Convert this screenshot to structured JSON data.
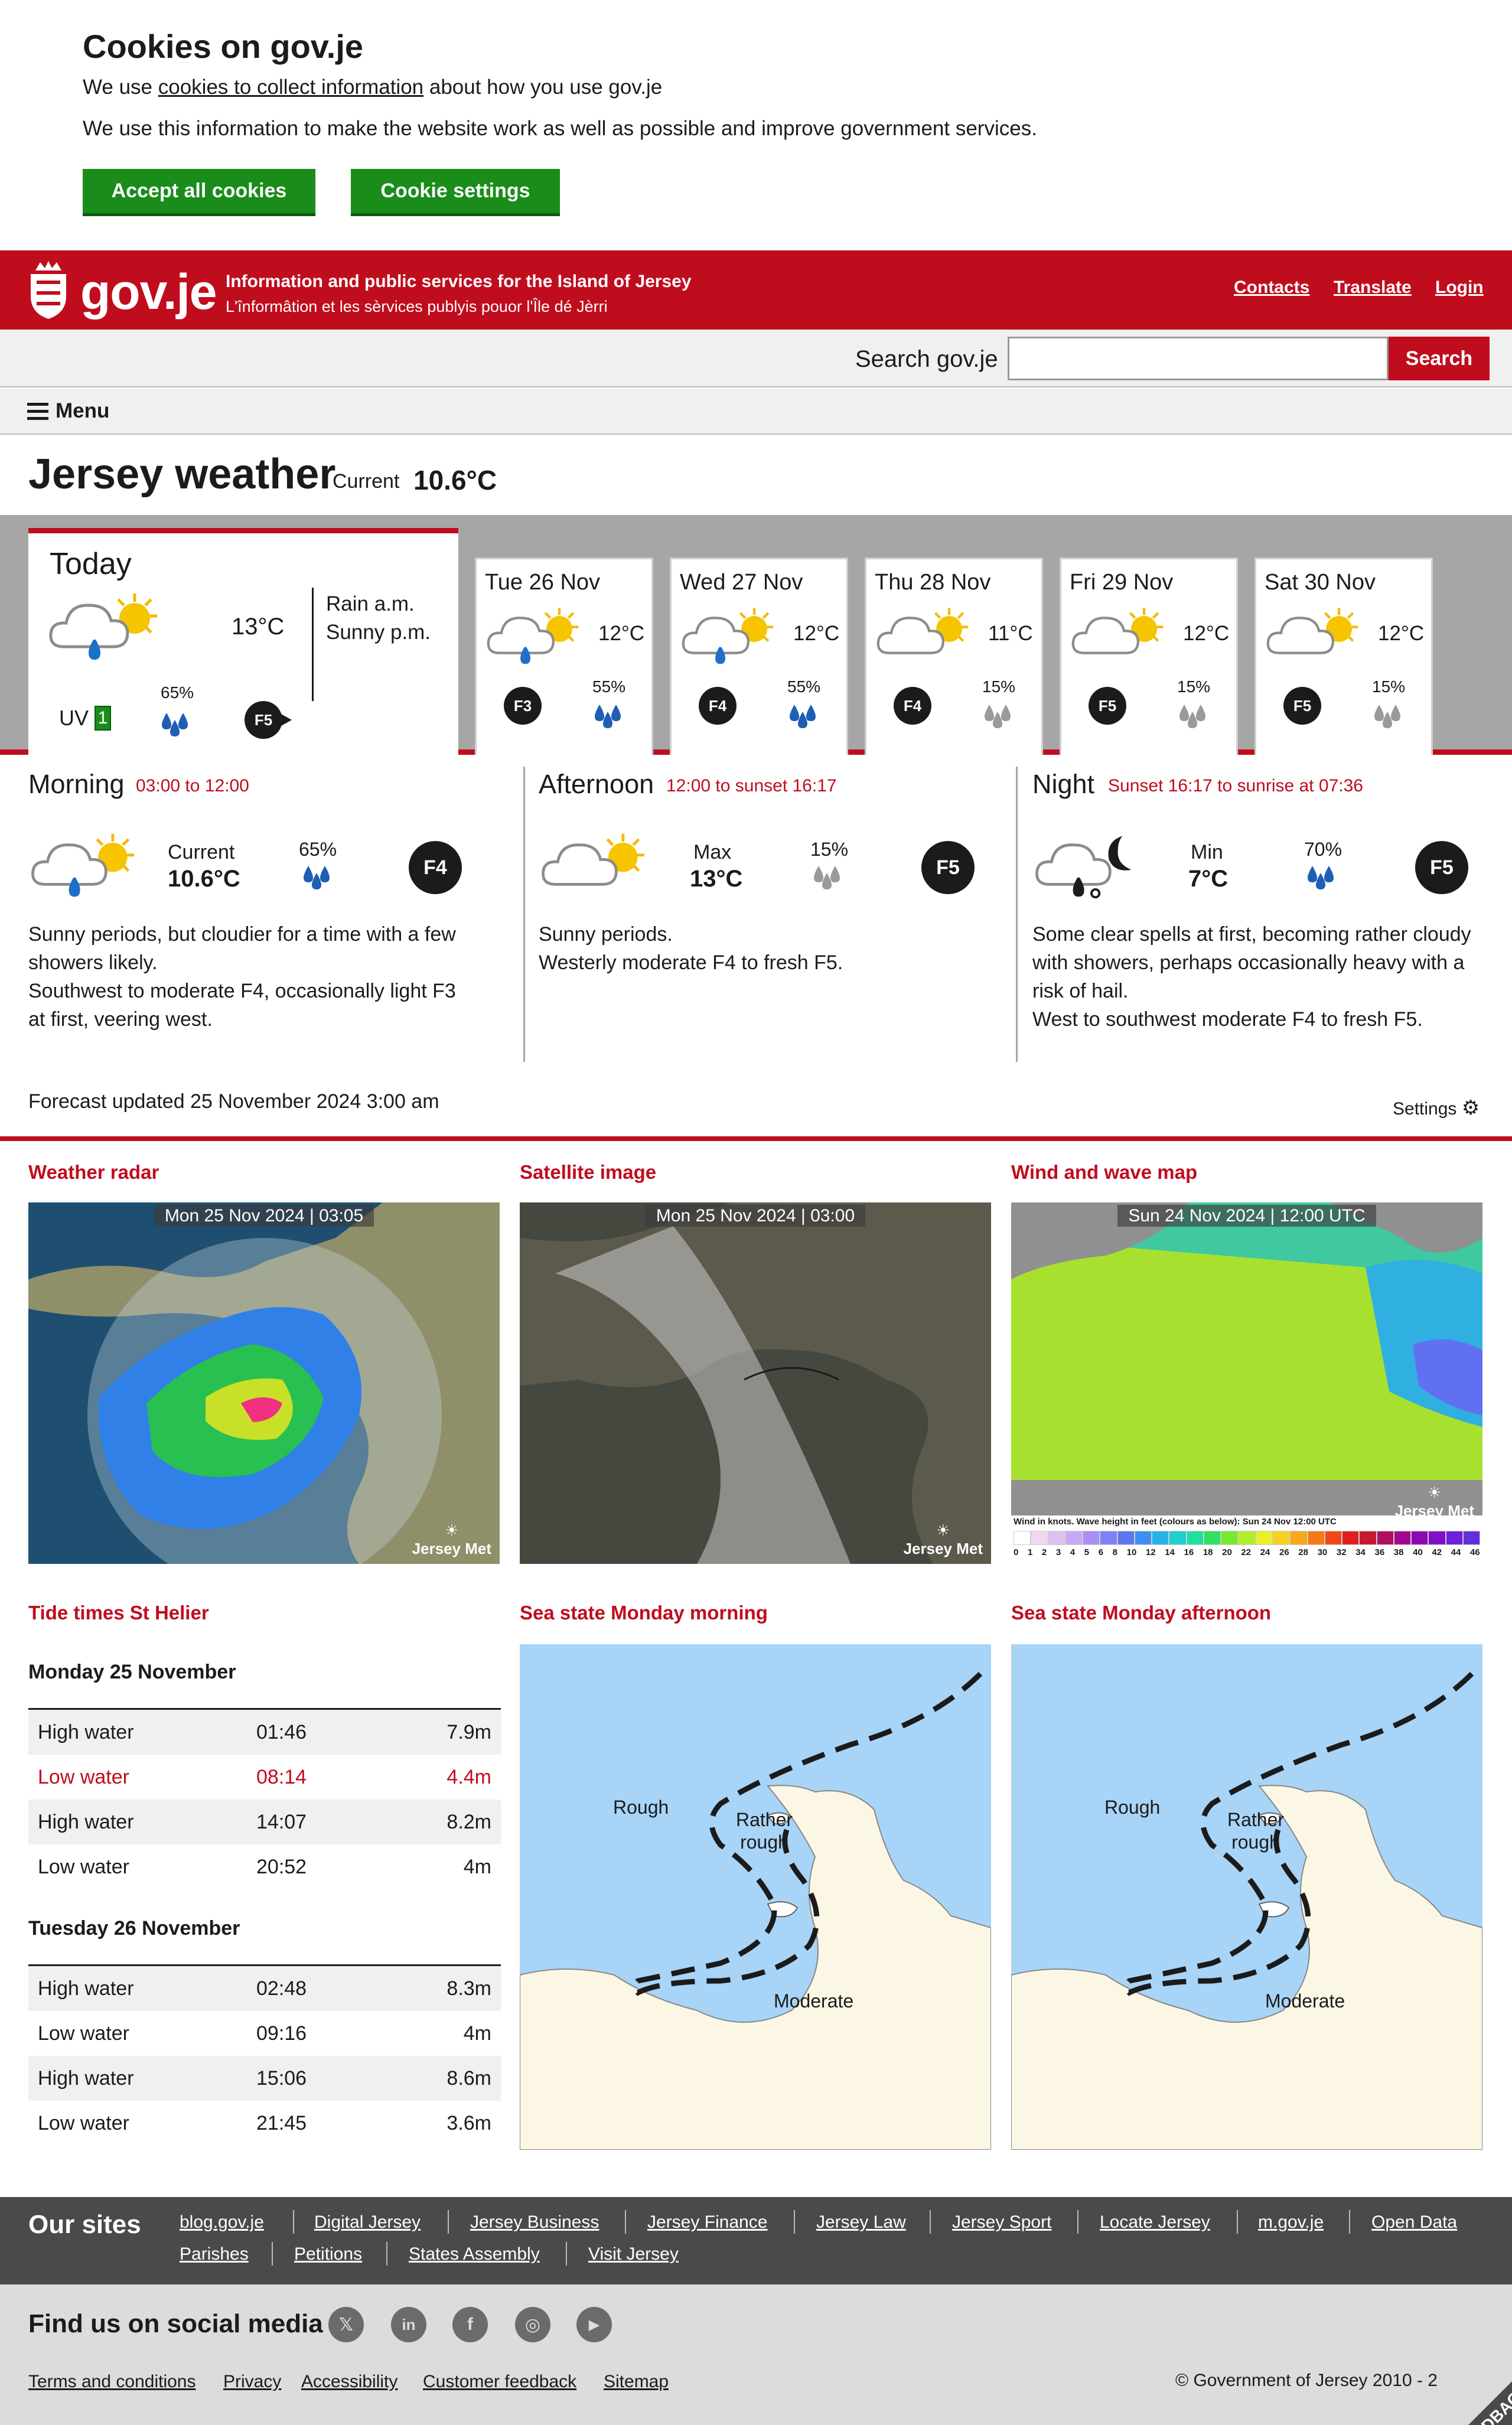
{
  "cookie": {
    "title": "Cookies on gov.je",
    "line1_pre": "We use ",
    "line1_link": "cookies to collect information",
    "line1_post": " about how you use gov.je",
    "line2": "We use this information to make the website work as well as possible and improve government services.",
    "accept_label": "Accept all cookies",
    "settings_label": "Cookie settings"
  },
  "header": {
    "logo": "gov.je",
    "tagline_en": "Information and public services for the Island of Jersey",
    "tagline_jer": "L'înformâtion et les sèrvices publyis pouor l'Île dé Jèrri",
    "links": [
      "Contacts",
      "Translate",
      "Login"
    ]
  },
  "search": {
    "label": "Search gov.je",
    "placeholder": "",
    "button": "Search"
  },
  "menu": {
    "label": "Menu"
  },
  "page": {
    "title": "Jersey weather",
    "current_label": "Current",
    "current_temp": "10.6°C"
  },
  "today": {
    "title": "Today",
    "temp": "13°C",
    "desc1": "Rain a.m.",
    "desc2": "Sunny p.m.",
    "uv_label": "UV",
    "uv_value": "1",
    "rain_pct": "65%",
    "wind": "F5"
  },
  "days": [
    {
      "name": "Tue 26 Nov",
      "temp": "12°C",
      "wind": "F3",
      "rain_pct": "55%"
    },
    {
      "name": "Wed 27 Nov",
      "temp": "12°C",
      "wind": "F4",
      "rain_pct": "55%"
    },
    {
      "name": "Thu 28 Nov",
      "temp": "11°C",
      "wind": "F4",
      "rain_pct": "15%"
    },
    {
      "name": "Fri 29 Nov",
      "temp": "12°C",
      "wind": "F5",
      "rain_pct": "15%"
    },
    {
      "name": "Sat 30 Nov",
      "temp": "12°C",
      "wind": "F5",
      "rain_pct": "15%"
    }
  ],
  "periods": {
    "morning": {
      "title": "Morning",
      "range": "03:00 to 12:00",
      "label": "Current",
      "value": "10.6°C",
      "rain_pct": "65%",
      "wind": "F4",
      "text1": "Sunny periods, but cloudier for a time with a few",
      "text2": "showers likely.",
      "text3": "Southwest to moderate F4, occasionally light F3",
      "text4": "at first, veering west."
    },
    "afternoon": {
      "title": "Afternoon",
      "range": "12:00 to sunset 16:17",
      "label": "Max",
      "value": "13°C",
      "rain_pct": "15%",
      "wind": "F5",
      "text1": "Sunny periods.",
      "text2": "Westerly moderate F4 to fresh F5."
    },
    "night": {
      "title": "Night",
      "range": "Sunset 16:17 to sunrise at 07:36",
      "label": "Min",
      "value": "7°C",
      "rain_pct": "70%",
      "wind": "F5",
      "text1": "Some clear spells at first, becoming rather cloudy",
      "text2": "with showers, perhaps occasionally heavy with a",
      "text3": "risk of hail.",
      "text4": "West to southwest moderate F4 to fresh F5."
    }
  },
  "updated": "Forecast updated 25 November 2024 3:00 am",
  "settings_label": "Settings",
  "maps": {
    "radar": {
      "title": "Weather radar",
      "stamp": "Mon 25 Nov 2024 | 03:05",
      "brand": "Jersey Met"
    },
    "satellite": {
      "title": "Satellite image",
      "stamp": "Mon 25 Nov 2024 | 03:00",
      "brand": "Jersey Met"
    },
    "wind": {
      "title": "Wind and wave map",
      "stamp": "Sun 24 Nov 2024 | 12:00 UTC",
      "brand": "Jersey Met",
      "legend": "Wind in knots. Wave height in feet (colours as below): Sun 24 Nov 12:00 UTC",
      "scale": [
        "0",
        "1",
        "2",
        "3",
        "4",
        "5",
        "6",
        "8",
        "10",
        "12",
        "14",
        "16",
        "18",
        "20",
        "22",
        "24",
        "26",
        "28",
        "30",
        "32",
        "34",
        "36",
        "38",
        "40",
        "42",
        "44",
        "46"
      ]
    },
    "sea_morning": {
      "title": "Sea state Monday morning",
      "rough": "Rough",
      "rather1": "Rather",
      "rather2": "rough",
      "moderate": "Moderate"
    },
    "sea_afternoon": {
      "title": "Sea state Monday afternoon",
      "rough": "Rough",
      "rather1": "Rather",
      "rather2": "rough",
      "moderate": "Moderate"
    }
  },
  "tides": {
    "title": "Tide times St Helier",
    "days": [
      {
        "day": "Monday 25 November",
        "rows": [
          {
            "type": "High water",
            "time": "01:46",
            "height": "7.9m"
          },
          {
            "type": "Low water",
            "time": "08:14",
            "height": "4.4m"
          },
          {
            "type": "High water",
            "time": "14:07",
            "height": "8.2m"
          },
          {
            "type": "Low water",
            "time": "20:52",
            "height": "4m"
          }
        ]
      },
      {
        "day": "Tuesday 26 November",
        "rows": [
          {
            "type": "High water",
            "time": "02:48",
            "height": "8.3m"
          },
          {
            "type": "Low water",
            "time": "09:16",
            "height": "4m"
          },
          {
            "type": "High water",
            "time": "15:06",
            "height": "8.6m"
          },
          {
            "type": "Low water",
            "time": "21:45",
            "height": "3.6m"
          }
        ]
      }
    ]
  },
  "footer": {
    "our_sites": "Our sites",
    "sites": [
      "blog.gov.je",
      "Digital Jersey",
      "Jersey Business",
      "Jersey Finance",
      "Jersey Law",
      "Jersey Sport",
      "Locate Jersey",
      "m.gov.je",
      "Open Data",
      "Parishes",
      "Petitions",
      "States Assembly",
      "Visit Jersey"
    ],
    "social_title": "Find us on social media",
    "bottom_links": [
      "Terms and conditions",
      "Privacy",
      "Accessibility",
      "Customer feedback",
      "Sitemap"
    ],
    "copyright": "© Government of Jersey 2010 - 2",
    "feedback": "FEEDBACK"
  },
  "colors": {
    "brand_red": "#c00d1e",
    "accept_green": "#1a8c1a",
    "footer_dark": "#4a4a4a"
  }
}
